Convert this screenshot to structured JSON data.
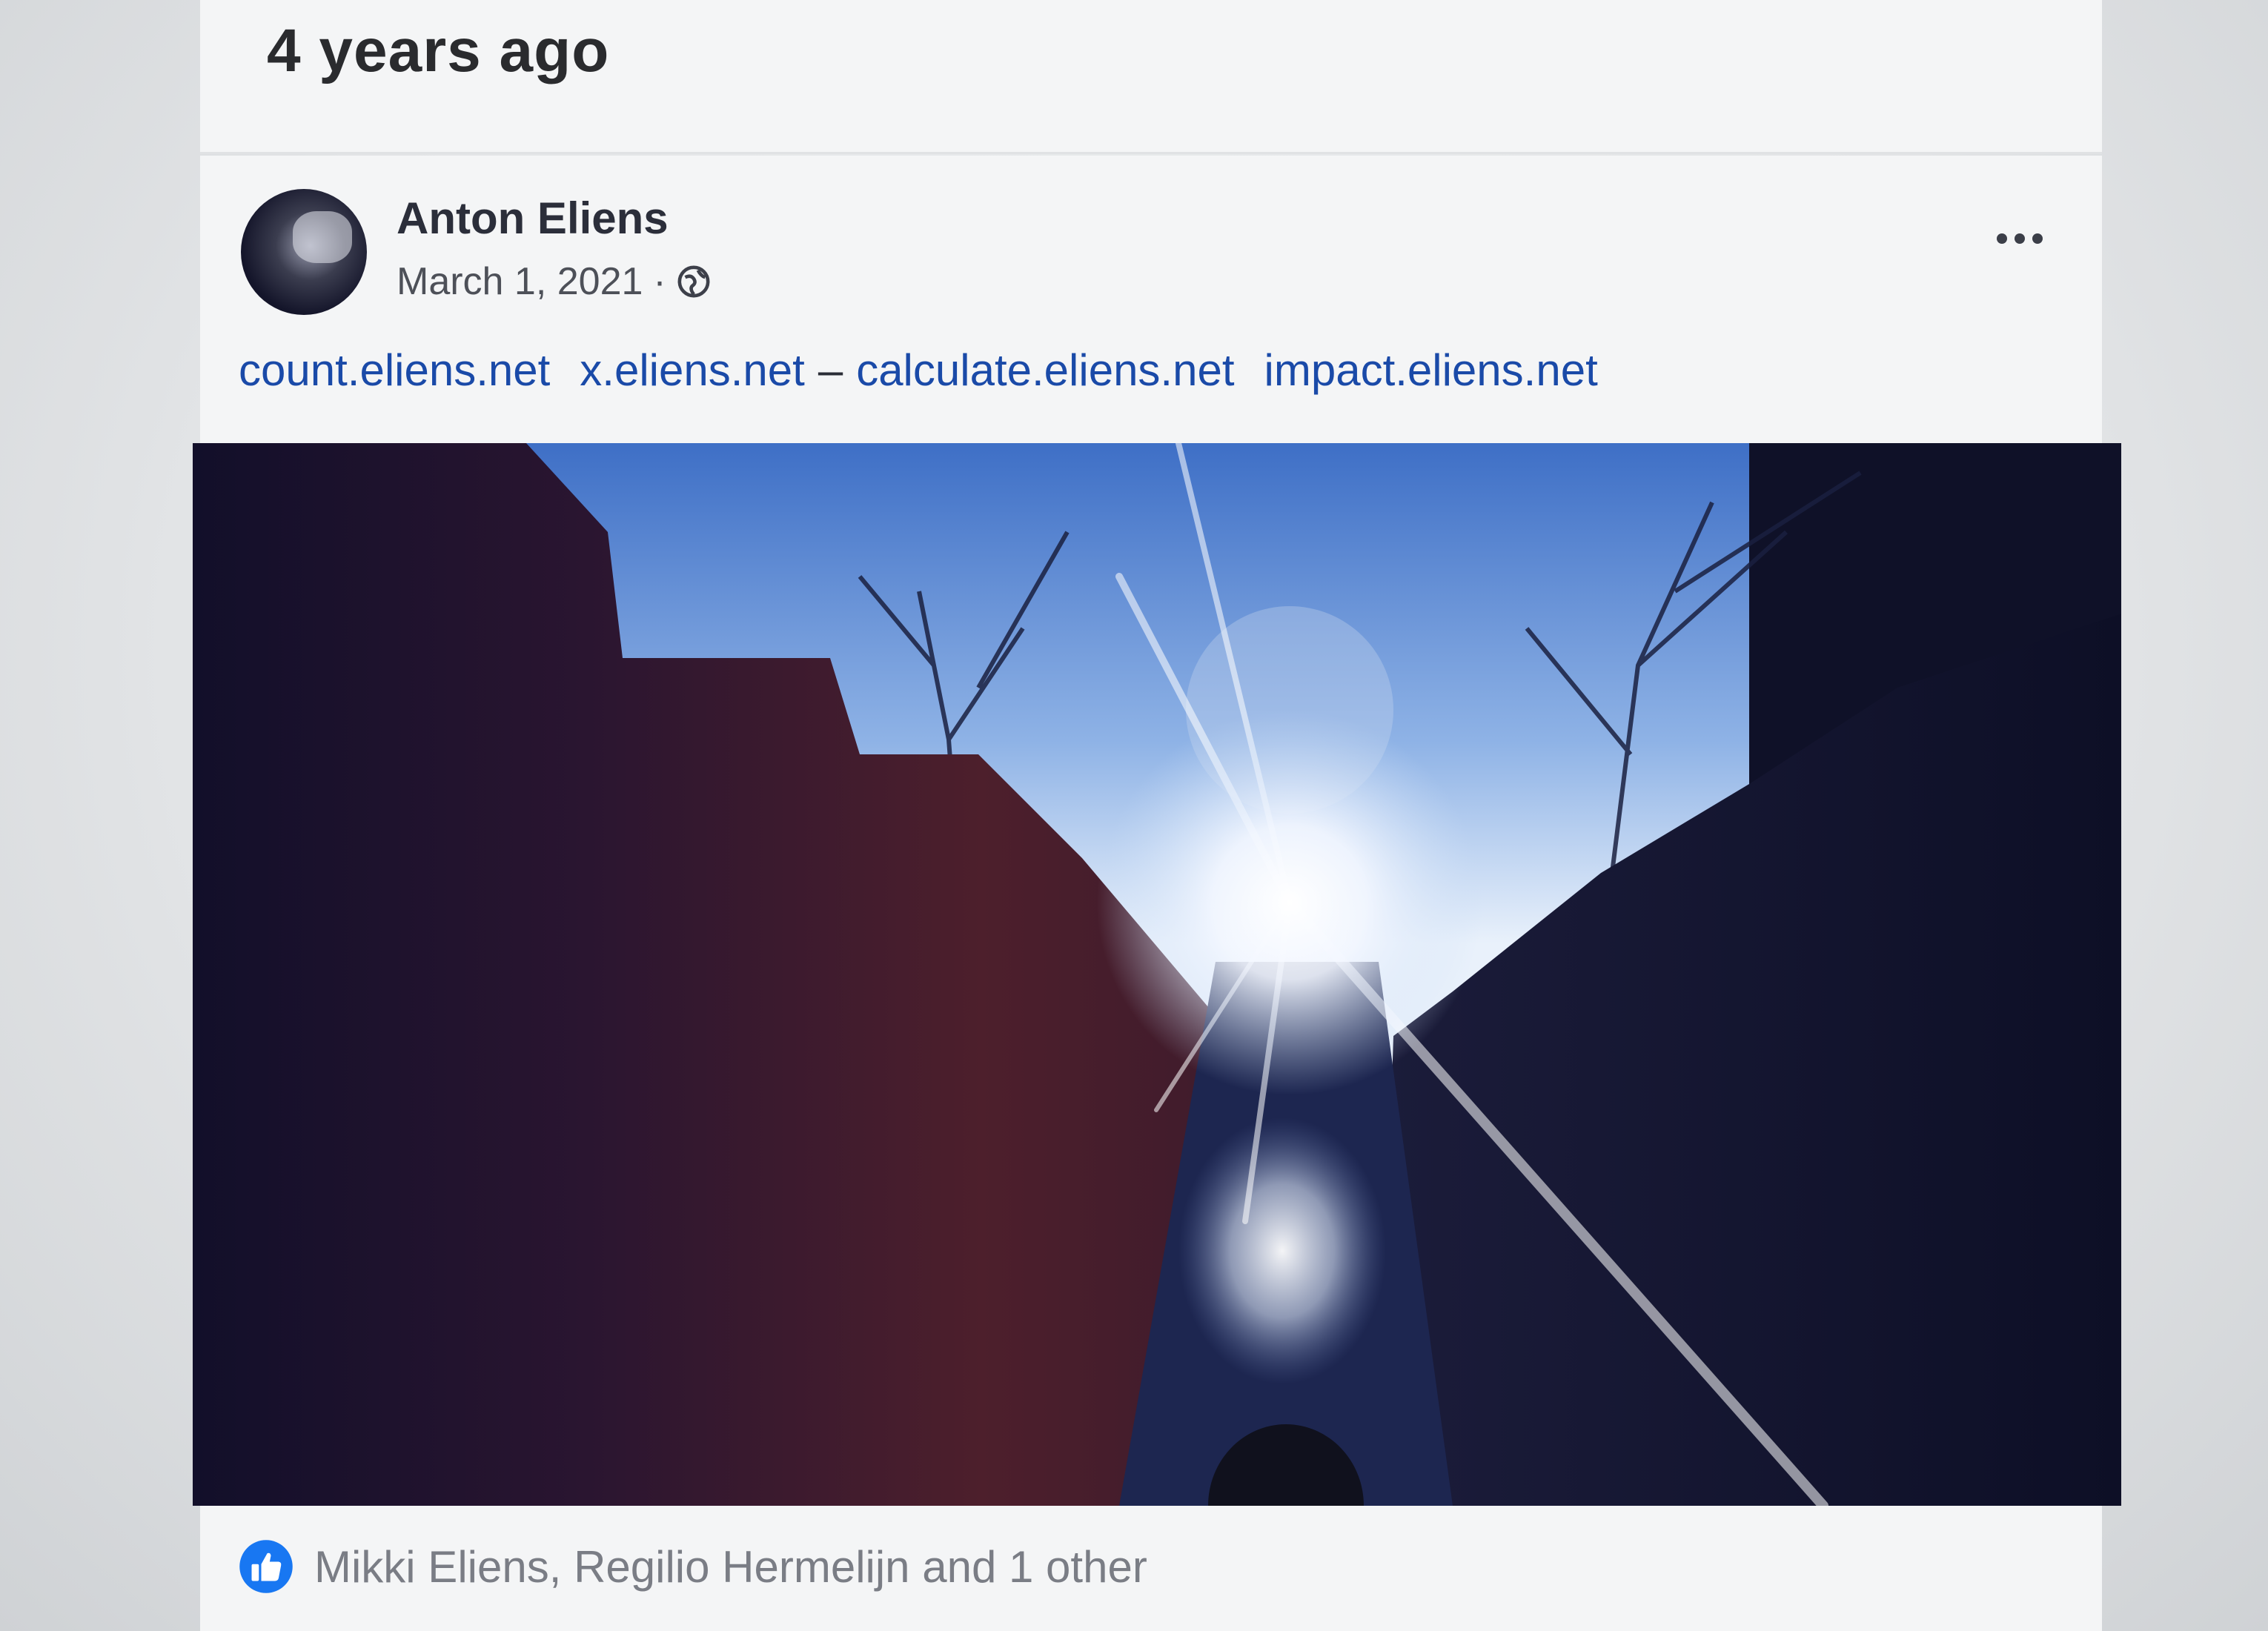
{
  "feed": {
    "previous_post": {
      "time_ago": "4 years ago"
    },
    "post": {
      "author": "Anton Eliens",
      "date": "March 1, 2021",
      "separator": "·",
      "audience_icon": "globe-icon",
      "menu_icon": "more-options-icon",
      "links": [
        "count.eliens.net",
        "x.eliens.net",
        "calculate.eliens.net",
        "impact.eliens.net"
      ],
      "link_separator": "–",
      "photo_description_icon": "photo",
      "reactions": {
        "icon": "like-icon",
        "text": "Mikki Eliens, Regilio Hermelijn and 1 other"
      }
    }
  },
  "colors": {
    "link": "#1a4aa8",
    "like_badge": "#1877f2",
    "card_background": "#f4f5f6"
  }
}
